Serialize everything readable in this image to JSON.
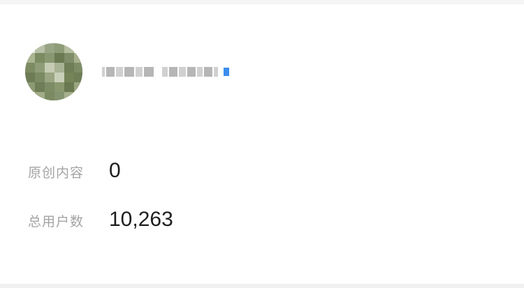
{
  "profile": {
    "avatar_icon": "avatar-icon",
    "name_obscured": true,
    "verified_badge_color": "#3d8ef0"
  },
  "stats": {
    "original_label": "原创内容",
    "original_value": "0",
    "users_label": "总用户数",
    "users_value": "10,263"
  },
  "colors": {
    "background": "#ffffff",
    "label": "#a3a3a3",
    "value": "#1e1e1e"
  }
}
